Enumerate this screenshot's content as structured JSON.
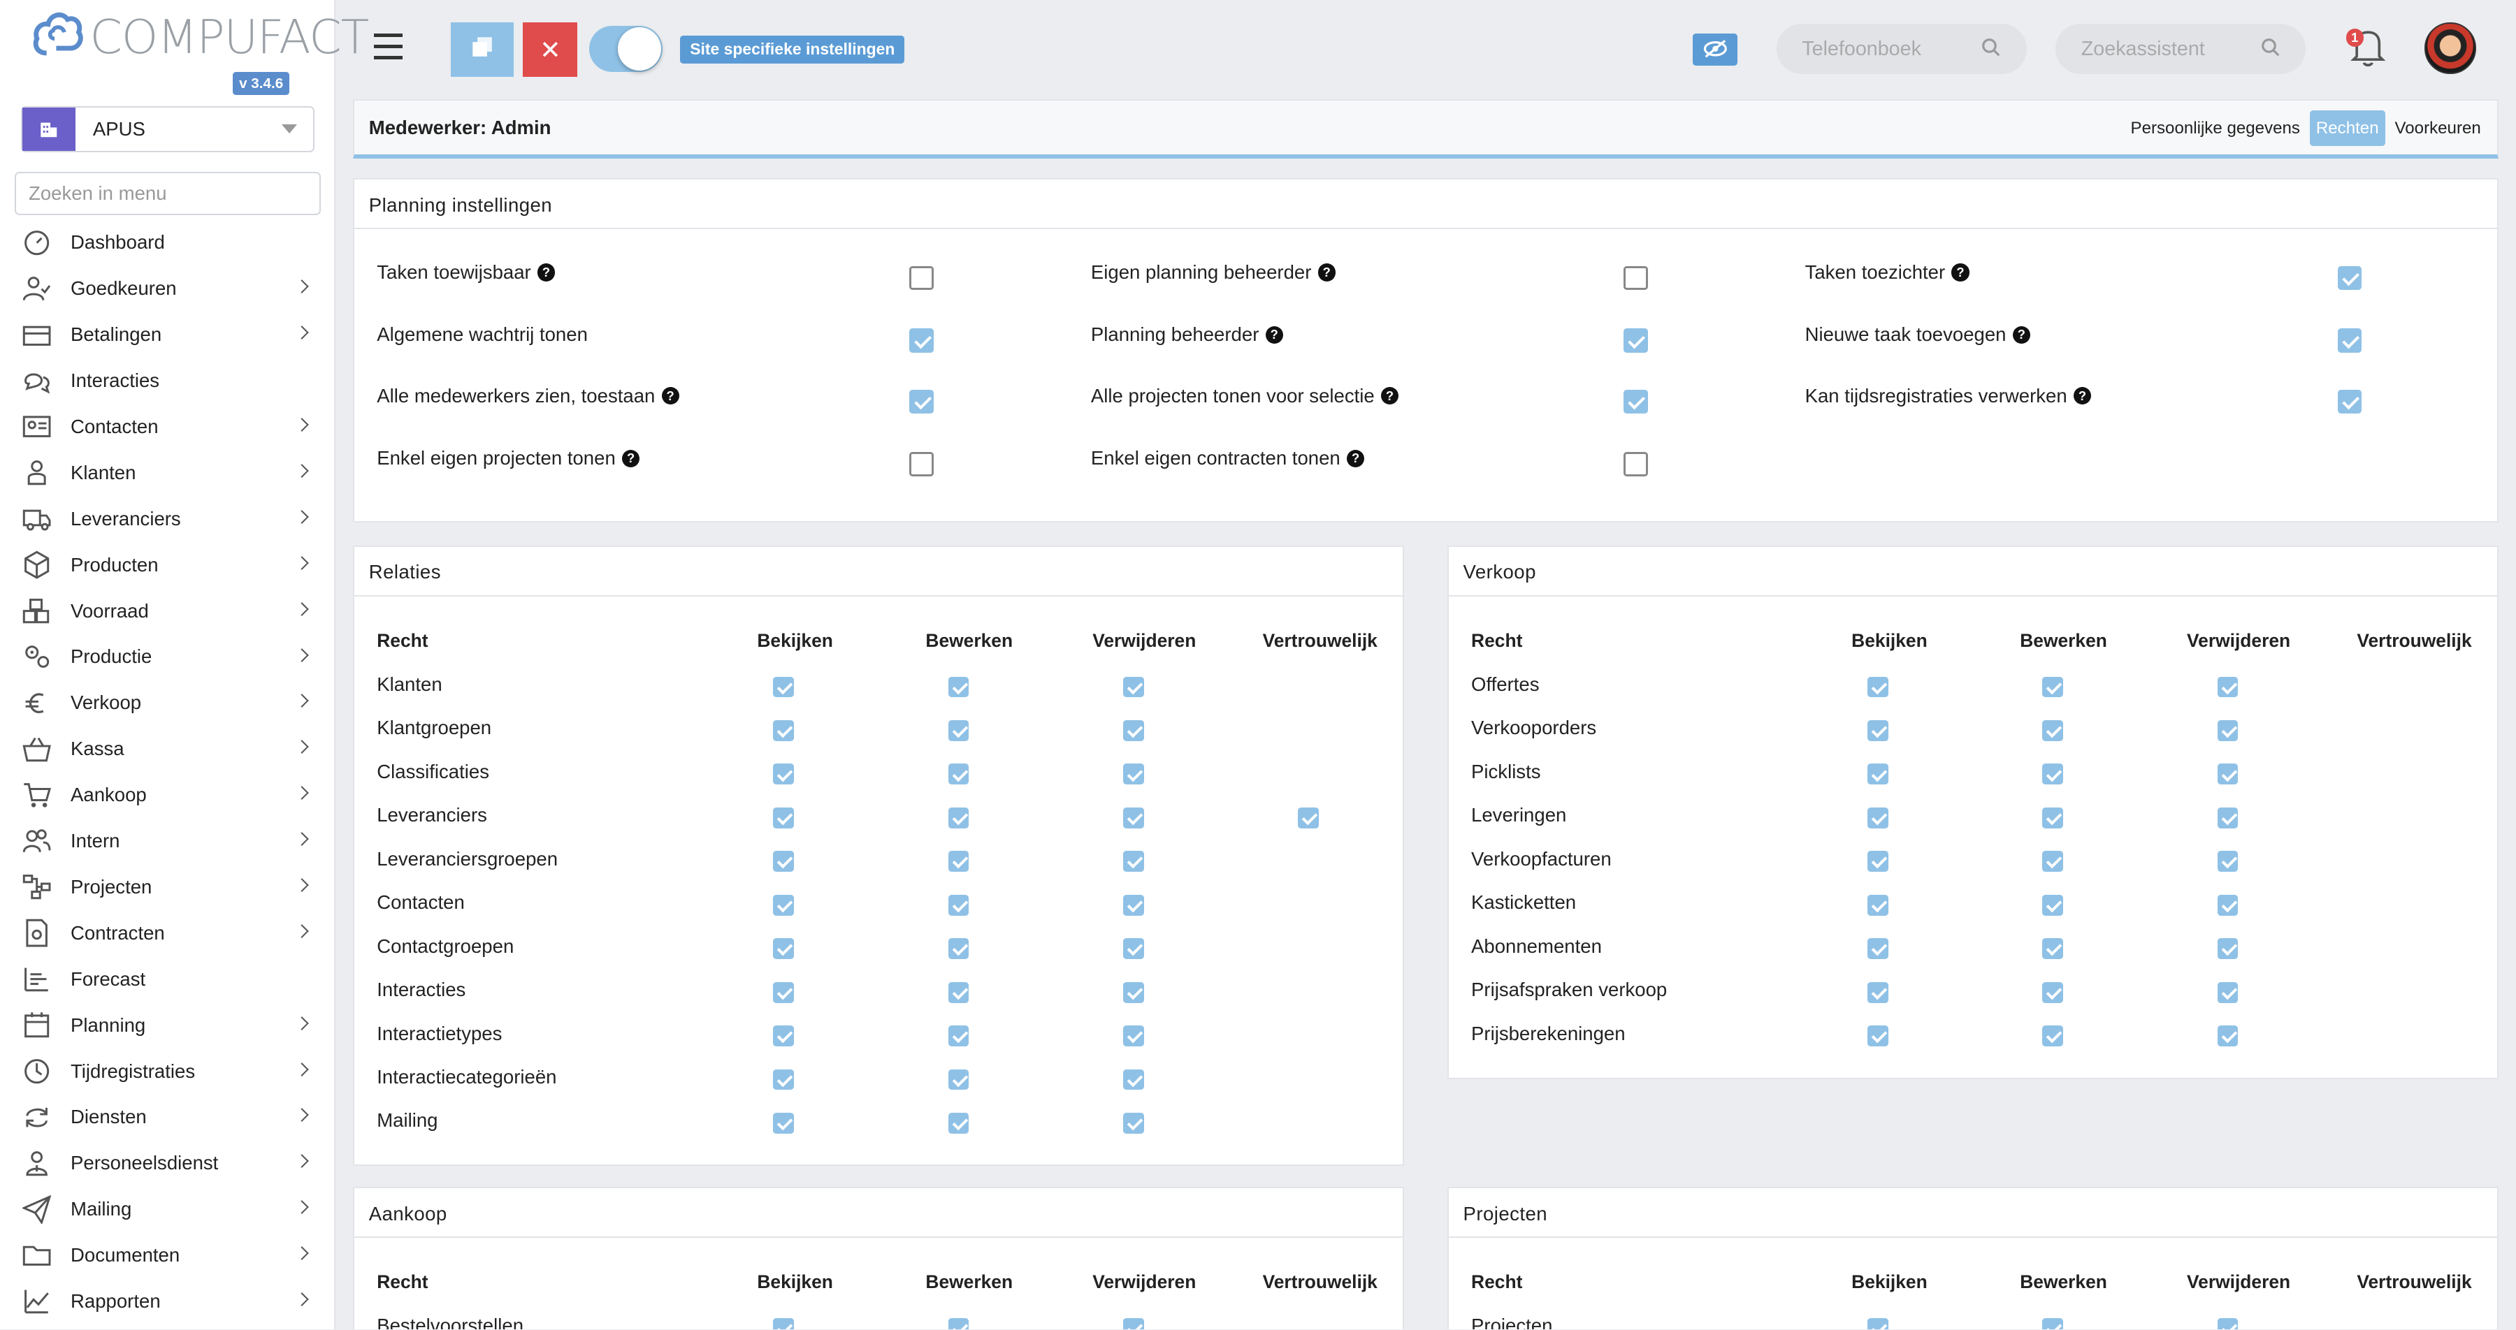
{
  "sidebar": {
    "brand": "COMPUFACT",
    "version": "v 3.4.6",
    "company": "APUS",
    "search_placeholder": "Zoeken in menu",
    "items": [
      {
        "label": "Dashboard",
        "icon": "dashboard-icon",
        "chev": false
      },
      {
        "label": "Goedkeuren",
        "icon": "approve-user-icon",
        "chev": true
      },
      {
        "label": "Betalingen",
        "icon": "payments-icon",
        "chev": true
      },
      {
        "label": "Interacties",
        "icon": "chat-icon",
        "chev": false
      },
      {
        "label": "Contacten",
        "icon": "contact-card-icon",
        "chev": true
      },
      {
        "label": "Klanten",
        "icon": "customer-icon",
        "chev": true
      },
      {
        "label": "Leveranciers",
        "icon": "truck-icon",
        "chev": true
      },
      {
        "label": "Producten",
        "icon": "box-icon",
        "chev": true
      },
      {
        "label": "Voorraad",
        "icon": "stock-icon",
        "chev": true
      },
      {
        "label": "Productie",
        "icon": "gears-icon",
        "chev": true
      },
      {
        "label": "Verkoop",
        "icon": "euro-icon",
        "chev": true
      },
      {
        "label": "Kassa",
        "icon": "basket-icon",
        "chev": true
      },
      {
        "label": "Aankoop",
        "icon": "cart-icon",
        "chev": true
      },
      {
        "label": "Intern",
        "icon": "users-icon",
        "chev": true
      },
      {
        "label": "Projecten",
        "icon": "project-tree-icon",
        "chev": true
      },
      {
        "label": "Contracten",
        "icon": "contract-icon",
        "chev": true
      },
      {
        "label": "Forecast",
        "icon": "forecast-icon",
        "chev": false
      },
      {
        "label": "Planning",
        "icon": "calendar-icon",
        "chev": true
      },
      {
        "label": "Tijdregistraties",
        "icon": "clock-icon",
        "chev": true
      },
      {
        "label": "Diensten",
        "icon": "refresh-icon",
        "chev": true
      },
      {
        "label": "Personeelsdienst",
        "icon": "staff-icon",
        "chev": true
      },
      {
        "label": "Mailing",
        "icon": "paper-plane-icon",
        "chev": true
      },
      {
        "label": "Documenten",
        "icon": "folder-icon",
        "chev": true
      },
      {
        "label": "Rapporten",
        "icon": "line-chart-icon",
        "chev": true
      }
    ]
  },
  "topbar": {
    "site_badge": "Site specifieke instellingen",
    "phonebook_placeholder": "Telefoonboek",
    "assistant_placeholder": "Zoekassistent",
    "notification_count": "1"
  },
  "employee": {
    "title": "Medewerker: Admin",
    "tabs": [
      {
        "label": "Persoonlijke gegevens",
        "active": false
      },
      {
        "label": "Rechten",
        "active": true
      },
      {
        "label": "Voorkeuren",
        "active": false
      }
    ]
  },
  "planning": {
    "title": "Planning instellingen",
    "columns": [
      [
        {
          "label": "Taken toewijsbaar",
          "checked": false
        },
        {
          "label": "Algemene wachtrij tonen",
          "checked": true
        },
        {
          "label": "Alle medewerkers zien, toestaan",
          "checked": true
        },
        {
          "label": "Enkel eigen projecten tonen",
          "checked": false
        }
      ],
      [
        {
          "label": "Eigen planning beheerder",
          "checked": false
        },
        {
          "label": "Planning beheerder",
          "checked": true
        },
        {
          "label": "Alle projecten tonen voor selectie",
          "checked": true
        },
        {
          "label": "Enkel eigen contracten tonen",
          "checked": false
        }
      ],
      [
        {
          "label": "Taken toezichter",
          "checked": true
        },
        {
          "label": "Nieuwe taak toevoegen",
          "checked": true
        },
        {
          "label": "Kan tijdsregistraties verwerken",
          "checked": true
        }
      ]
    ]
  },
  "headers": [
    "Recht",
    "Bekijken",
    "Bewerken",
    "Verwijderen",
    "Vertrouwelijk"
  ],
  "relaties": {
    "title": "Relaties",
    "rows": [
      {
        "name": "Klanten",
        "v": [
          true,
          true,
          true,
          null
        ]
      },
      {
        "name": "Klantgroepen",
        "v": [
          true,
          true,
          true,
          null
        ]
      },
      {
        "name": "Classificaties",
        "v": [
          true,
          true,
          true,
          null
        ]
      },
      {
        "name": "Leveranciers",
        "v": [
          true,
          true,
          true,
          true
        ]
      },
      {
        "name": "Leveranciersgroepen",
        "v": [
          true,
          true,
          true,
          null
        ]
      },
      {
        "name": "Contacten",
        "v": [
          true,
          true,
          true,
          null
        ]
      },
      {
        "name": "Contactgroepen",
        "v": [
          true,
          true,
          true,
          null
        ]
      },
      {
        "name": "Interacties",
        "v": [
          true,
          true,
          true,
          null
        ]
      },
      {
        "name": "Interactietypes",
        "v": [
          true,
          true,
          true,
          null
        ]
      },
      {
        "name": "Interactiecategorieën",
        "v": [
          true,
          true,
          true,
          null
        ]
      },
      {
        "name": "Mailing",
        "v": [
          true,
          true,
          true,
          null
        ]
      }
    ]
  },
  "verkoop": {
    "title": "Verkoop",
    "rows": [
      {
        "name": "Offertes",
        "v": [
          true,
          true,
          true,
          null
        ]
      },
      {
        "name": "Verkooporders",
        "v": [
          true,
          true,
          true,
          null
        ]
      },
      {
        "name": "Picklists",
        "v": [
          true,
          true,
          true,
          null
        ]
      },
      {
        "name": "Leveringen",
        "v": [
          true,
          true,
          true,
          null
        ]
      },
      {
        "name": "Verkoopfacturen",
        "v": [
          true,
          true,
          true,
          null
        ]
      },
      {
        "name": "Kasticketten",
        "v": [
          true,
          true,
          true,
          null
        ]
      },
      {
        "name": "Abonnementen",
        "v": [
          true,
          true,
          true,
          null
        ]
      },
      {
        "name": "Prijsafspraken verkoop",
        "v": [
          true,
          true,
          true,
          null
        ]
      },
      {
        "name": "Prijsberekeningen",
        "v": [
          true,
          true,
          true,
          null
        ]
      }
    ]
  },
  "aankoop": {
    "title": "Aankoop",
    "rows": [
      {
        "name": "Bestelvoorstellen",
        "v": [
          true,
          true,
          true,
          null
        ]
      }
    ]
  },
  "projecten": {
    "title": "Projecten",
    "rows": [
      {
        "name": "Projecten",
        "v": [
          true,
          true,
          true,
          null
        ]
      }
    ]
  }
}
